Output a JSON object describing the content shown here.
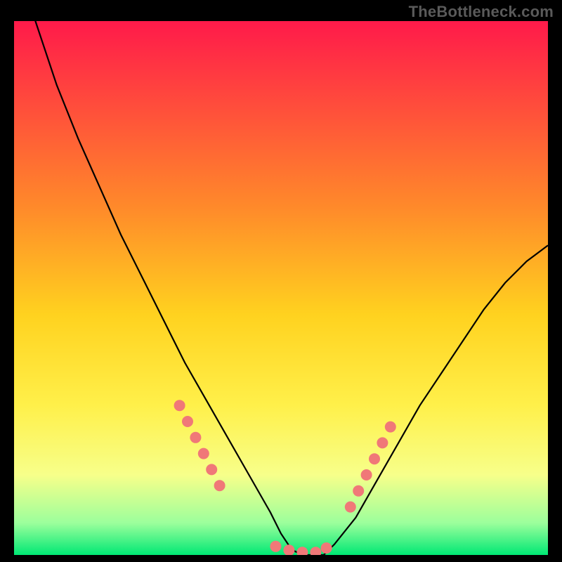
{
  "watermark": "TheBottleneck.com",
  "colors": {
    "frame": "#000000",
    "curve": "#000000",
    "dots": "#f07878",
    "gradient_top": "#ff1a4a",
    "gradient_mid1": "#ff8a2a",
    "gradient_mid2": "#ffd21f",
    "gradient_mid3": "#fff04a",
    "gradient_mid4": "#f7ff8a",
    "gradient_bottom1": "#9cff9c",
    "gradient_bottom2": "#00e874"
  },
  "chart_data": {
    "type": "line",
    "title": "",
    "xlabel": "",
    "ylabel": "",
    "xlim": [
      0,
      100
    ],
    "ylim": [
      0,
      100
    ],
    "series": [
      {
        "name": "curve",
        "x": [
          0,
          4,
          8,
          12,
          16,
          20,
          24,
          28,
          32,
          36,
          40,
          44,
          48,
          50,
          52,
          54,
          56,
          58,
          60,
          64,
          68,
          72,
          76,
          80,
          84,
          88,
          92,
          96,
          100
        ],
        "y": [
          114,
          100,
          88,
          78,
          69,
          60,
          52,
          44,
          36,
          29,
          22,
          15,
          8,
          4,
          1,
          0,
          0,
          0,
          2,
          7,
          14,
          21,
          28,
          34,
          40,
          46,
          51,
          55,
          58
        ]
      }
    ],
    "dot_clusters": [
      {
        "name": "left-cluster",
        "points": [
          {
            "x": 31,
            "y": 28
          },
          {
            "x": 32.5,
            "y": 25
          },
          {
            "x": 34,
            "y": 22
          },
          {
            "x": 35.5,
            "y": 19
          },
          {
            "x": 37,
            "y": 16
          },
          {
            "x": 38.5,
            "y": 13
          }
        ]
      },
      {
        "name": "bottom-cluster",
        "points": [
          {
            "x": 49,
            "y": 1.6
          },
          {
            "x": 51.5,
            "y": 0.9
          },
          {
            "x": 54,
            "y": 0.5
          },
          {
            "x": 56.5,
            "y": 0.5
          },
          {
            "x": 58.5,
            "y": 1.3
          }
        ]
      },
      {
        "name": "right-cluster",
        "points": [
          {
            "x": 63,
            "y": 9
          },
          {
            "x": 64.5,
            "y": 12
          },
          {
            "x": 66,
            "y": 15
          },
          {
            "x": 67.5,
            "y": 18
          },
          {
            "x": 69,
            "y": 21
          },
          {
            "x": 70.5,
            "y": 24
          }
        ]
      }
    ]
  }
}
